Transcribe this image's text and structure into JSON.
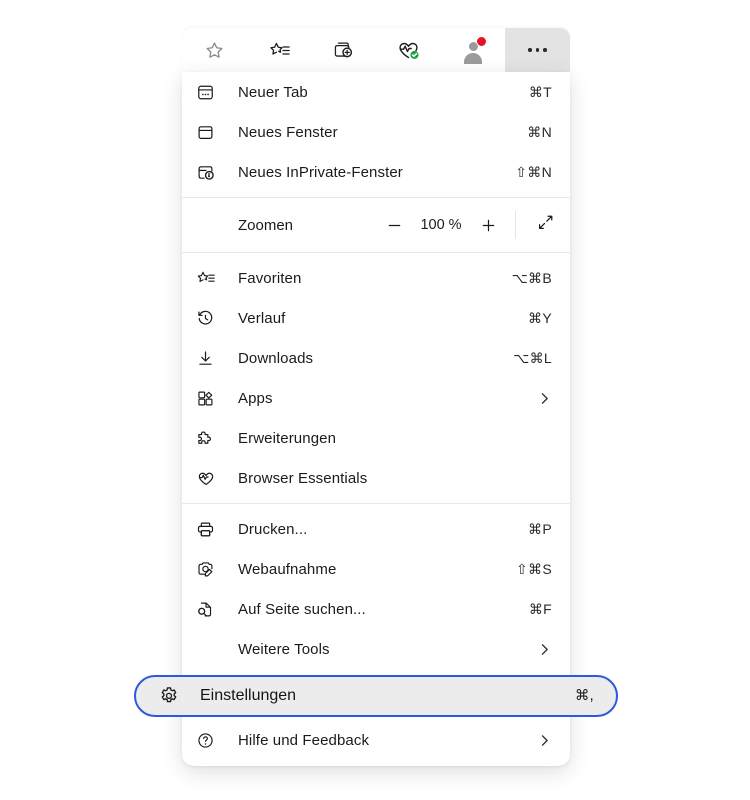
{
  "toolbar": {
    "buttons": [
      {
        "name": "add-favorite",
        "icon": "star-outline-icon",
        "label": "Zu Favoriten hinzufügen"
      },
      {
        "name": "favorites",
        "icon": "favorites-star-list-icon",
        "label": "Favoriten"
      },
      {
        "name": "collections",
        "icon": "collections-add-icon",
        "label": "Sammlungen"
      },
      {
        "name": "browser-essentials",
        "icon": "heart-pulse-check-icon",
        "label": "Browser Essentials"
      },
      {
        "name": "profile",
        "icon": "avatar-icon",
        "label": "Profil"
      },
      {
        "name": "settings-and-more",
        "icon": "ellipsis-icon",
        "label": "Einstellungen und mehr"
      }
    ]
  },
  "menu": {
    "group1": [
      {
        "label": "Neuer Tab",
        "accel": "⌘T",
        "icon": "new-tab-icon"
      },
      {
        "label": "Neues Fenster",
        "accel": "⌘N",
        "icon": "new-window-icon"
      },
      {
        "label": "Neues InPrivate-Fenster",
        "accel": "⇧⌘N",
        "icon": "inprivate-window-icon"
      }
    ],
    "zoom": {
      "label": "Zoomen",
      "minus": "−",
      "value": "100 %",
      "plus": "+",
      "fullscreen_label": "Vollbild"
    },
    "group2": [
      {
        "label": "Favoriten",
        "accel": "⌥⌘B",
        "icon": "favorites-star-list-icon"
      },
      {
        "label": "Verlauf",
        "accel": "⌘Y",
        "icon": "history-clock-icon"
      },
      {
        "label": "Downloads",
        "accel": "⌥⌘L",
        "icon": "download-arrow-icon"
      },
      {
        "label": "Apps",
        "accel": "",
        "icon": "apps-grid-icon",
        "submenu": true
      },
      {
        "label": "Erweiterungen",
        "accel": "",
        "icon": "puzzle-piece-icon"
      },
      {
        "label": "Browser Essentials",
        "accel": "",
        "icon": "heart-pulse-icon"
      }
    ],
    "group3": [
      {
        "label": "Drucken...",
        "accel": "⌘P",
        "icon": "printer-icon"
      },
      {
        "label": "Webaufnahme",
        "accel": "⇧⌘S",
        "icon": "web-capture-icon"
      },
      {
        "label": "Auf Seite suchen...",
        "accel": "⌘F",
        "icon": "find-on-page-icon"
      },
      {
        "label": "Weitere Tools",
        "accel": "",
        "icon": "",
        "submenu": true
      }
    ],
    "settings": {
      "label": "Einstellungen",
      "accel": "⌘,",
      "icon": "gear-icon"
    },
    "help": {
      "label": "Hilfe und Feedback",
      "accel": "",
      "icon": "question-circle-icon",
      "submenu": true
    }
  },
  "colors": {
    "focus_ring": "#2f58e0",
    "focus_fill": "#ececec",
    "panel_bg": "#ffffff",
    "badge": "#e81123",
    "essentials_check": "#19a33c",
    "separator": "#e8e8e8"
  }
}
